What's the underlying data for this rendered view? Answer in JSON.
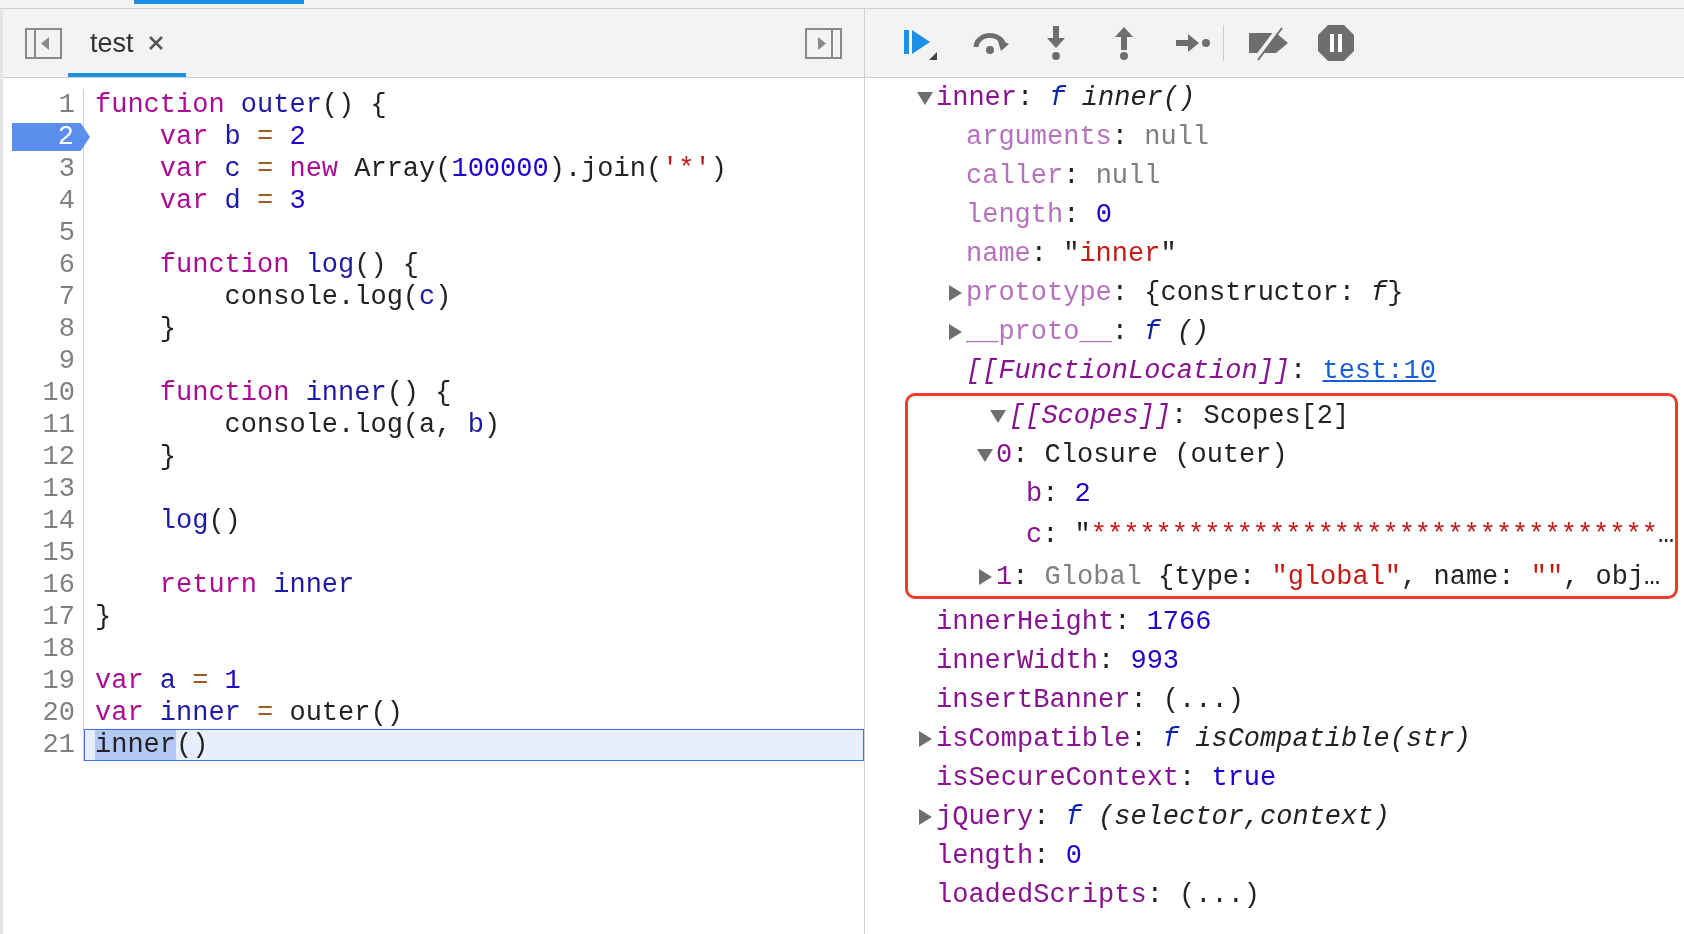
{
  "editor": {
    "tabs": [
      {
        "label": "test",
        "selected": true
      }
    ],
    "lines": [
      {
        "number": "1",
        "paused": false,
        "current": false,
        "tokens": [
          {
            "kind": "kw",
            "text": "function"
          },
          {
            "kind": "def",
            "text": " outer"
          },
          {
            "kind": "plain",
            "text": "() {"
          }
        ]
      },
      {
        "number": "2",
        "paused": true,
        "current": false,
        "tokens": [
          {
            "kind": "kw",
            "text": "    var"
          },
          {
            "kind": "def",
            "text": " b"
          },
          {
            "kind": "op",
            "text": " ="
          },
          {
            "kind": "num",
            "text": " 2"
          }
        ]
      },
      {
        "number": "3",
        "paused": false,
        "current": false,
        "tokens": [
          {
            "kind": "kw",
            "text": "    var"
          },
          {
            "kind": "def",
            "text": " c"
          },
          {
            "kind": "op",
            "text": " ="
          },
          {
            "kind": "kw",
            "text": " new"
          },
          {
            "kind": "plain",
            "text": " Array("
          },
          {
            "kind": "num",
            "text": "100000"
          },
          {
            "kind": "plain",
            "text": ").join("
          },
          {
            "kind": "str",
            "text": "'*'"
          },
          {
            "kind": "plain",
            "text": ")"
          }
        ]
      },
      {
        "number": "4",
        "paused": false,
        "current": false,
        "tokens": [
          {
            "kind": "kw",
            "text": "    var"
          },
          {
            "kind": "def",
            "text": " d"
          },
          {
            "kind": "op",
            "text": " ="
          },
          {
            "kind": "num",
            "text": " 3"
          }
        ]
      },
      {
        "number": "5",
        "paused": false,
        "current": false
      },
      {
        "number": "6",
        "paused": false,
        "current": false,
        "tokens": [
          {
            "kind": "kw",
            "text": "    function"
          },
          {
            "kind": "def",
            "text": " log"
          },
          {
            "kind": "plain",
            "text": "() {"
          }
        ]
      },
      {
        "number": "7",
        "paused": false,
        "current": false,
        "tokens": [
          {
            "kind": "plain",
            "text": "        console.log("
          },
          {
            "kind": "def",
            "text": "c"
          },
          {
            "kind": "plain",
            "text": ")"
          }
        ]
      },
      {
        "number": "8",
        "paused": false,
        "current": false,
        "tokens": [
          {
            "kind": "plain",
            "text": "    }"
          }
        ]
      },
      {
        "number": "9",
        "paused": false,
        "current": false
      },
      {
        "number": "10",
        "paused": false,
        "current": false,
        "tokens": [
          {
            "kind": "kw",
            "text": "    function"
          },
          {
            "kind": "def",
            "text": " inner"
          },
          {
            "kind": "plain",
            "text": "() {"
          }
        ]
      },
      {
        "number": "11",
        "paused": false,
        "current": false,
        "tokens": [
          {
            "kind": "plain",
            "text": "        console.log(a, "
          },
          {
            "kind": "def",
            "text": "b"
          },
          {
            "kind": "plain",
            "text": ")"
          }
        ]
      },
      {
        "number": "12",
        "paused": false,
        "current": false,
        "tokens": [
          {
            "kind": "plain",
            "text": "    }"
          }
        ]
      },
      {
        "number": "13",
        "paused": false,
        "current": false
      },
      {
        "number": "14",
        "paused": false,
        "current": false,
        "tokens": [
          {
            "kind": "def",
            "text": "    log"
          },
          {
            "kind": "plain",
            "text": "()"
          }
        ]
      },
      {
        "number": "15",
        "paused": false,
        "current": false
      },
      {
        "number": "16",
        "paused": false,
        "current": false,
        "tokens": [
          {
            "kind": "kw",
            "text": "    return"
          },
          {
            "kind": "def",
            "text": " inner"
          }
        ]
      },
      {
        "number": "17",
        "paused": false,
        "current": false,
        "tokens": [
          {
            "kind": "plain",
            "text": "}"
          }
        ]
      },
      {
        "number": "18",
        "paused": false,
        "current": false
      },
      {
        "number": "19",
        "paused": false,
        "current": false,
        "tokens": [
          {
            "kind": "kw",
            "text": "var"
          },
          {
            "kind": "def",
            "text": " a"
          },
          {
            "kind": "op",
            "text": " ="
          },
          {
            "kind": "num",
            "text": " 1"
          }
        ]
      },
      {
        "number": "20",
        "paused": false,
        "current": false,
        "tokens": [
          {
            "kind": "kw",
            "text": "var"
          },
          {
            "kind": "def",
            "text": " inner"
          },
          {
            "kind": "op",
            "text": " ="
          },
          {
            "kind": "plain",
            "text": " outer()"
          }
        ]
      },
      {
        "number": "21",
        "paused": false,
        "current": true,
        "tokens": [
          {
            "kind": "sel",
            "text": "inner"
          },
          {
            "kind": "plain",
            "text": "()"
          }
        ]
      }
    ]
  },
  "debugger": {
    "buttons": [
      {
        "kind": "resume"
      },
      {
        "kind": "step-over"
      },
      {
        "kind": "step-into"
      },
      {
        "kind": "step-out"
      },
      {
        "kind": "step"
      },
      {
        "kind": "separator"
      },
      {
        "kind": "deactivate"
      },
      {
        "kind": "pause-exceptions"
      }
    ],
    "scope_tree": [
      {
        "kind": "branch",
        "expanded": true,
        "parts": [
          {
            "kind": "key",
            "text": "inner"
          },
          {
            "kind": "punct",
            "text": ": "
          },
          {
            "kind": "fn",
            "text": "f"
          },
          {
            "kind": "italic",
            "text": " inner()"
          }
        ],
        "children": [
          {
            "kind": "leaf",
            "parts": [
              {
                "kind": "dim",
                "text": "arguments"
              },
              {
                "kind": "punct",
                "text": ": "
              },
              {
                "kind": "null",
                "text": "null"
              }
            ]
          },
          {
            "kind": "leaf",
            "parts": [
              {
                "kind": "dim",
                "text": "caller"
              },
              {
                "kind": "punct",
                "text": ": "
              },
              {
                "kind": "null",
                "text": "null"
              }
            ]
          },
          {
            "kind": "leaf",
            "parts": [
              {
                "kind": "dim",
                "text": "length"
              },
              {
                "kind": "punct",
                "text": ": "
              },
              {
                "kind": "num",
                "text": "0"
              }
            ]
          },
          {
            "kind": "leaf",
            "parts": [
              {
                "kind": "dim",
                "text": "name"
              },
              {
                "kind": "punct",
                "text": ": \""
              },
              {
                "kind": "str",
                "text": "inner"
              },
              {
                "kind": "plain",
                "text": "\""
              }
            ]
          },
          {
            "kind": "branch",
            "expanded": false,
            "parts": [
              {
                "kind": "dim",
                "text": "prototype"
              },
              {
                "kind": "punct",
                "text": ": {constructor: "
              },
              {
                "kind": "italic",
                "text": "f"
              },
              {
                "kind": "plain",
                "text": "}"
              }
            ]
          },
          {
            "kind": "branch",
            "expanded": false,
            "parts": [
              {
                "kind": "dim",
                "text": "__proto__"
              },
              {
                "kind": "punct",
                "text": ": "
              },
              {
                "kind": "fn",
                "text": "f"
              },
              {
                "kind": "italic",
                "text": " ()"
              }
            ]
          },
          {
            "kind": "leaf",
            "parts": [
              {
                "kind": "internal",
                "text": "[[FunctionLocation]]"
              },
              {
                "kind": "punct",
                "text": ": "
              },
              {
                "kind": "link",
                "text": "test:10"
              }
            ]
          },
          {
            "kind": "branch",
            "expanded": true,
            "boxed": true,
            "parts": [
              {
                "kind": "internal",
                "text": "[[Scopes]]"
              },
              {
                "kind": "punct",
                "text": ": "
              },
              {
                "kind": "plain",
                "text": "Scopes[2]"
              }
            ],
            "children": [
              {
                "kind": "branch",
                "expanded": true,
                "parts": [
                  {
                    "kind": "key",
                    "text": "0"
                  },
                  {
                    "kind": "punct",
                    "text": ": "
                  },
                  {
                    "kind": "plain",
                    "text": "Closure (outer)"
                  }
                ],
                "children": [
                  {
                    "kind": "leaf",
                    "parts": [
                      {
                        "kind": "key",
                        "text": "b"
                      },
                      {
                        "kind": "punct",
                        "text": ": "
                      },
                      {
                        "kind": "num",
                        "text": "2"
                      }
                    ]
                  },
                  {
                    "kind": "leaf",
                    "parts": [
                      {
                        "kind": "key",
                        "text": "c"
                      },
                      {
                        "kind": "punct",
                        "text": ": \""
                      },
                      {
                        "kind": "str",
                        "text": "***********************************"
                      },
                      {
                        "kind": "plain",
                        "text": "…"
                      }
                    ]
                  }
                ]
              },
              {
                "kind": "branch",
                "expanded": false,
                "parts": [
                  {
                    "kind": "key",
                    "text": "1"
                  },
                  {
                    "kind": "punct",
                    "text": ": "
                  },
                  {
                    "kind": "gray",
                    "text": "Global"
                  },
                  {
                    "kind": "plain",
                    "text": " {type: "
                  },
                  {
                    "kind": "str",
                    "text": "\"global\""
                  },
                  {
                    "kind": "plain",
                    "text": ", name: "
                  },
                  {
                    "kind": "str",
                    "text": "\"\""
                  },
                  {
                    "kind": "plain",
                    "text": ", obj…"
                  }
                ]
              }
            ]
          }
        ]
      },
      {
        "kind": "leaf",
        "parts": [
          {
            "kind": "key",
            "text": "innerHeight"
          },
          {
            "kind": "punct",
            "text": ": "
          },
          {
            "kind": "num",
            "text": "1766"
          }
        ]
      },
      {
        "kind": "leaf",
        "parts": [
          {
            "kind": "key",
            "text": "innerWidth"
          },
          {
            "kind": "punct",
            "text": ": "
          },
          {
            "kind": "num",
            "text": "993"
          }
        ]
      },
      {
        "kind": "leaf",
        "parts": [
          {
            "kind": "key",
            "text": "insertBanner"
          },
          {
            "kind": "punct",
            "text": ": (...)"
          }
        ]
      },
      {
        "kind": "branch",
        "expanded": false,
        "parts": [
          {
            "kind": "key",
            "text": "isCompatible"
          },
          {
            "kind": "punct",
            "text": ": "
          },
          {
            "kind": "fn",
            "text": "f"
          },
          {
            "kind": "italic",
            "text": " isCompatible(str)"
          }
        ]
      },
      {
        "kind": "leaf",
        "parts": [
          {
            "kind": "key",
            "text": "isSecureContext"
          },
          {
            "kind": "punct",
            "text": ": "
          },
          {
            "kind": "num",
            "text": "true"
          }
        ]
      },
      {
        "kind": "branch",
        "expanded": false,
        "parts": [
          {
            "kind": "key",
            "text": "jQuery"
          },
          {
            "kind": "punct",
            "text": ": "
          },
          {
            "kind": "fn",
            "text": "f"
          },
          {
            "kind": "italic",
            "text": " (selector,context)"
          }
        ]
      },
      {
        "kind": "leaf",
        "parts": [
          {
            "kind": "key",
            "text": "length"
          },
          {
            "kind": "punct",
            "text": ": "
          },
          {
            "kind": "num",
            "text": "0"
          }
        ]
      },
      {
        "kind": "leaf",
        "parts": [
          {
            "kind": "key",
            "text": "loadedScripts"
          },
          {
            "kind": "punct",
            "text": ": (...)"
          }
        ]
      }
    ]
  }
}
